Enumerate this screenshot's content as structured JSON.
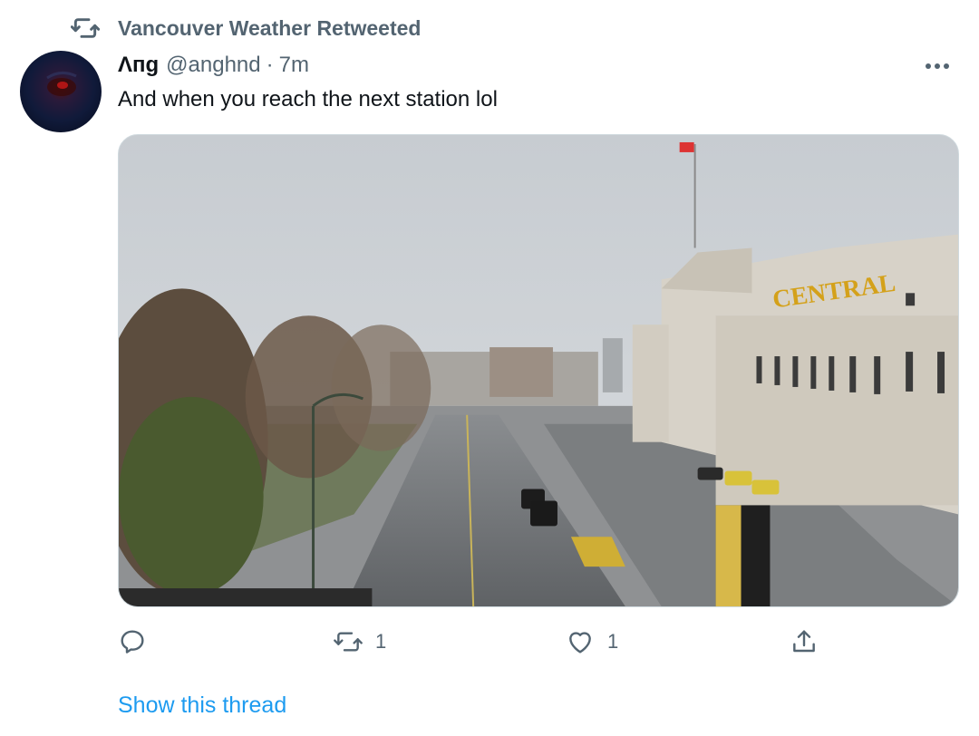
{
  "retweet_context": {
    "icon": "retweet-icon",
    "label": "Vancouver Weather Retweeted"
  },
  "author": {
    "display_name": "Λпɡ",
    "handle": "@anghnd",
    "separator": "·",
    "time": "7m"
  },
  "more_icon": "more-icon",
  "tweet": {
    "text": "And when you reach the next station lol"
  },
  "media": {
    "sign_text": "CENTRAL"
  },
  "actions": {
    "reply": {
      "icon": "reply-icon",
      "count": ""
    },
    "retweet": {
      "icon": "retweet-icon",
      "count": "1"
    },
    "like": {
      "icon": "heart-icon",
      "count": "1"
    },
    "share": {
      "icon": "share-icon",
      "count": ""
    }
  },
  "show_thread": "Show this thread",
  "colors": {
    "secondary_text": "#536471",
    "primary_text": "#0f1419",
    "link": "#1d9bf0"
  }
}
